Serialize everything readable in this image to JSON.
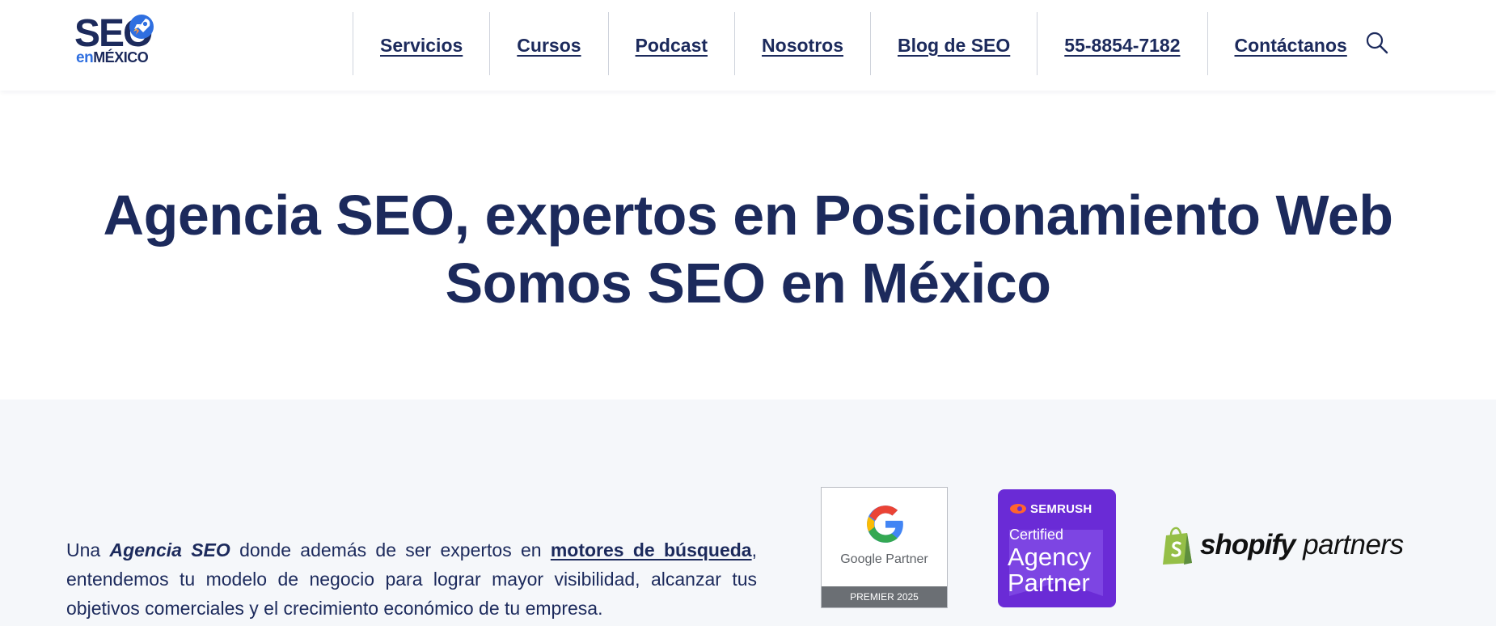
{
  "logo": {
    "main": "SEO",
    "sub_en": "en",
    "sub_mx": "MÉXICO"
  },
  "nav": {
    "items": [
      {
        "label": "Servicios"
      },
      {
        "label": "Cursos"
      },
      {
        "label": "Podcast"
      },
      {
        "label": "Nosotros"
      },
      {
        "label": "Blog de SEO"
      },
      {
        "label": "55-8854-7182"
      },
      {
        "label": "Contáctanos"
      }
    ],
    "search_icon": "search-icon"
  },
  "hero": {
    "title_line1": "Agencia SEO, expertos en Posicionamiento Web",
    "title_line2": "Somos SEO en México"
  },
  "intro": {
    "text_before": "Una ",
    "emphasis": "Agencia SEO",
    "text_middle": " donde además de ser expertos en ",
    "link_label": "motores de búsqueda",
    "text_after": ", entendemos tu modelo de negocio para lograr mayor visibilidad, alcanzar tus objetivos comerciales y el crecimiento económico de tu empresa."
  },
  "badges": {
    "google": {
      "label": "Google Partner",
      "footer": "PREMIER 2025"
    },
    "semrush": {
      "brand": "SEMRUSH",
      "certified": "Certified",
      "line1": "Agency",
      "line2": "Partner"
    },
    "shopify": {
      "brand": "shopify",
      "suffix": "partners"
    }
  },
  "colors": {
    "primary_navy": "#1c2a5c",
    "accent_blue": "#2f6fe0",
    "section_bg": "#f5f7fa",
    "semrush_purple": "#6a2bd6",
    "semrush_orange": "#ff642d",
    "shopify_green": "#95bf47"
  }
}
